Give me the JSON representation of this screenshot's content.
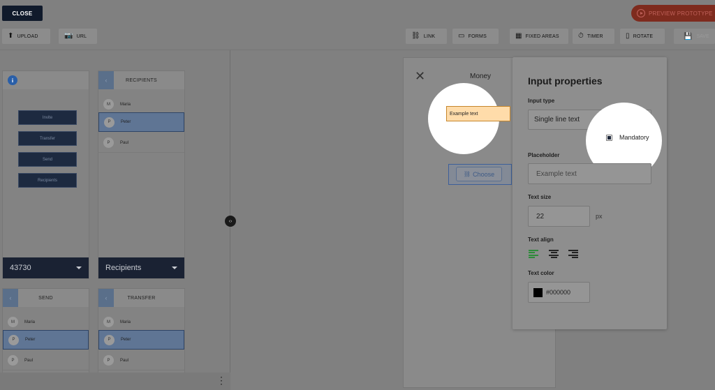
{
  "topbar": {
    "close_label": "CLOSE",
    "preview_label": "PREVIEW PROTOTYPE"
  },
  "toolbar": {
    "upload_label": "UPLOAD",
    "url_label": "URL",
    "link_label": "LINK",
    "forms_label": "FORMS",
    "fixed_areas_label": "FIXED AREAS",
    "timer_label": "TIMER",
    "rotate_label": "ROTATE",
    "save_label": "SAVE"
  },
  "screens": {
    "first": {
      "buttons": [
        "Invite",
        "Transfer",
        "Send",
        "Recipients"
      ],
      "footer_label": "43730"
    },
    "recipients": {
      "title": "RECIPIENTS",
      "items": [
        {
          "initial": "M",
          "name": "Maria"
        },
        {
          "initial": "P",
          "name": "Peter"
        },
        {
          "initial": "P",
          "name": "Paul"
        }
      ],
      "footer_label": "Recipients"
    },
    "send": {
      "title": "SEND",
      "items": [
        {
          "initial": "M",
          "name": "Maria"
        },
        {
          "initial": "P",
          "name": "Peter"
        },
        {
          "initial": "P",
          "name": "Paul"
        }
      ]
    },
    "transfer": {
      "title": "TRANSFER",
      "items": [
        {
          "initial": "M",
          "name": "Maria"
        },
        {
          "initial": "P",
          "name": "Peter"
        },
        {
          "initial": "P",
          "name": "Paul"
        }
      ]
    }
  },
  "preview": {
    "title": "Money",
    "example_text": "Example text",
    "choose_label": "Choose"
  },
  "properties": {
    "title": "Input properties",
    "input_type_label": "Input type",
    "input_type_value": "Single line text",
    "mandatory_label": "Mandatory",
    "mandatory_checked": true,
    "placeholder_label": "Placeholder",
    "placeholder_value": "Example text",
    "text_size_label": "Text size",
    "text_size_value": "22",
    "text_size_unit": "px",
    "text_align_label": "Text align",
    "text_align_selected": "left",
    "text_color_label": "Text color",
    "text_color_value": "#000000"
  },
  "colors": {
    "accent_green": "#2e8b3a",
    "selected_row": "#5f7594",
    "preview_button": "#7e2b1e"
  }
}
